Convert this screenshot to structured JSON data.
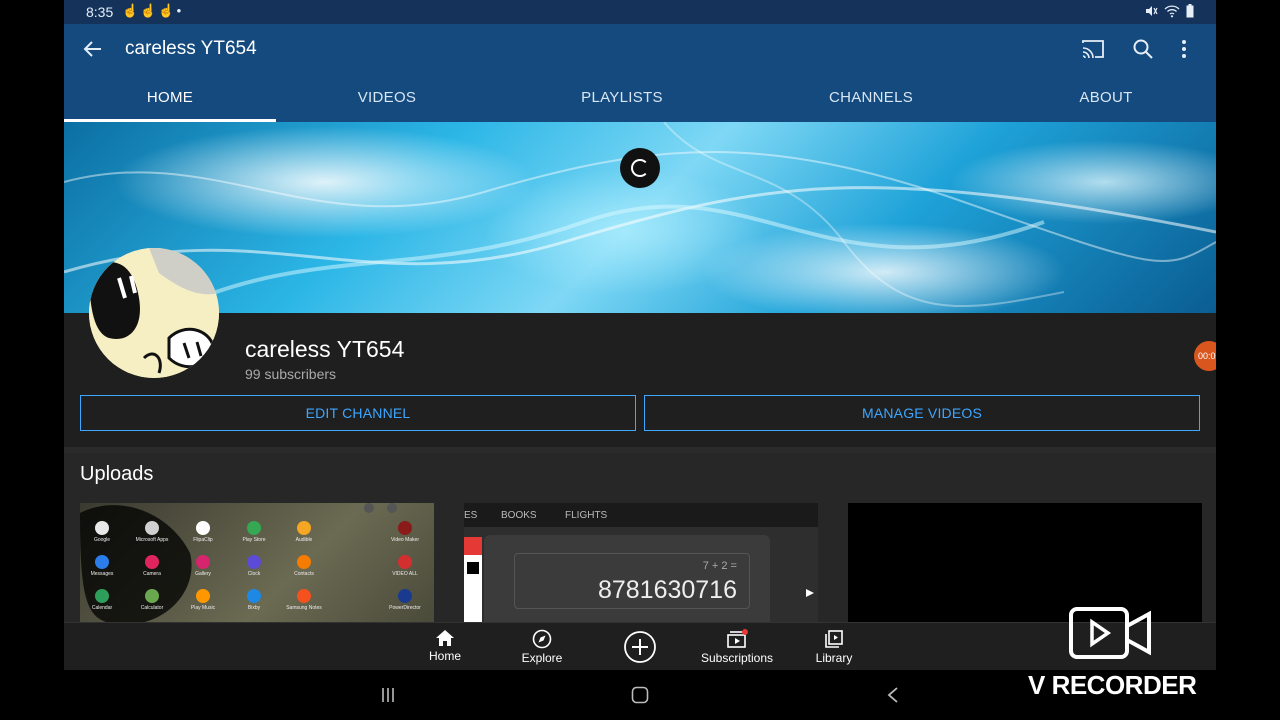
{
  "status_bar": {
    "time": "8:35",
    "notification_icons": [
      "hand-icon",
      "hand-icon",
      "hand-icon",
      "dot-icon"
    ],
    "system_icons": [
      "mute-icon",
      "wifi-icon",
      "battery-icon"
    ]
  },
  "app_bar": {
    "title": "careless YT654",
    "background": "#144a7d",
    "actions": [
      "cast-icon",
      "search-icon",
      "more-icon"
    ]
  },
  "tabs": [
    {
      "label": "HOME",
      "active": true
    },
    {
      "label": "VIDEOS",
      "active": false
    },
    {
      "label": "PLAYLISTS",
      "active": false
    },
    {
      "label": "CHANNELS",
      "active": false
    },
    {
      "label": "ABOUT",
      "active": false
    }
  ],
  "channel": {
    "name": "careless YT654",
    "subscribers": "99 subscribers"
  },
  "actions": {
    "edit_channel": "EDIT CHANNEL",
    "manage_videos": "MANAGE VIDEOS",
    "accent": "#3ea6ff"
  },
  "recording_badge": "00:0",
  "uploads": {
    "title": "Uploads",
    "thumbs": [
      {
        "kind": "app-drawer",
        "apps": [
          "Google",
          "Microsoft Apps",
          "FlipaClip",
          "Play Store",
          "Audible",
          "Video Maker",
          "Messages",
          "Camera",
          "Gallery",
          "Clock",
          "Contacts",
          "VIDEO ALL",
          "Calendar",
          "Calculator",
          "Play Music",
          "Bixby",
          "Samsung Notes",
          "PowerDirector"
        ]
      },
      {
        "kind": "calculator",
        "tabs": [
          "ES",
          "BOOKS",
          "FLIGHTS"
        ],
        "expression": "7 + 2 =",
        "result": "8781630716"
      },
      {
        "kind": "black"
      }
    ]
  },
  "bottom_nav": [
    {
      "label": "Home",
      "icon": "home-icon"
    },
    {
      "label": "Explore",
      "icon": "compass-icon"
    },
    {
      "label": "",
      "icon": "create-icon"
    },
    {
      "label": "Subscriptions",
      "icon": "subscriptions-icon"
    },
    {
      "label": "Library",
      "icon": "library-icon"
    }
  ],
  "system_nav": [
    "recents-icon",
    "home-button-icon",
    "back-icon"
  ],
  "watermark": {
    "label": "V RECORDER"
  }
}
